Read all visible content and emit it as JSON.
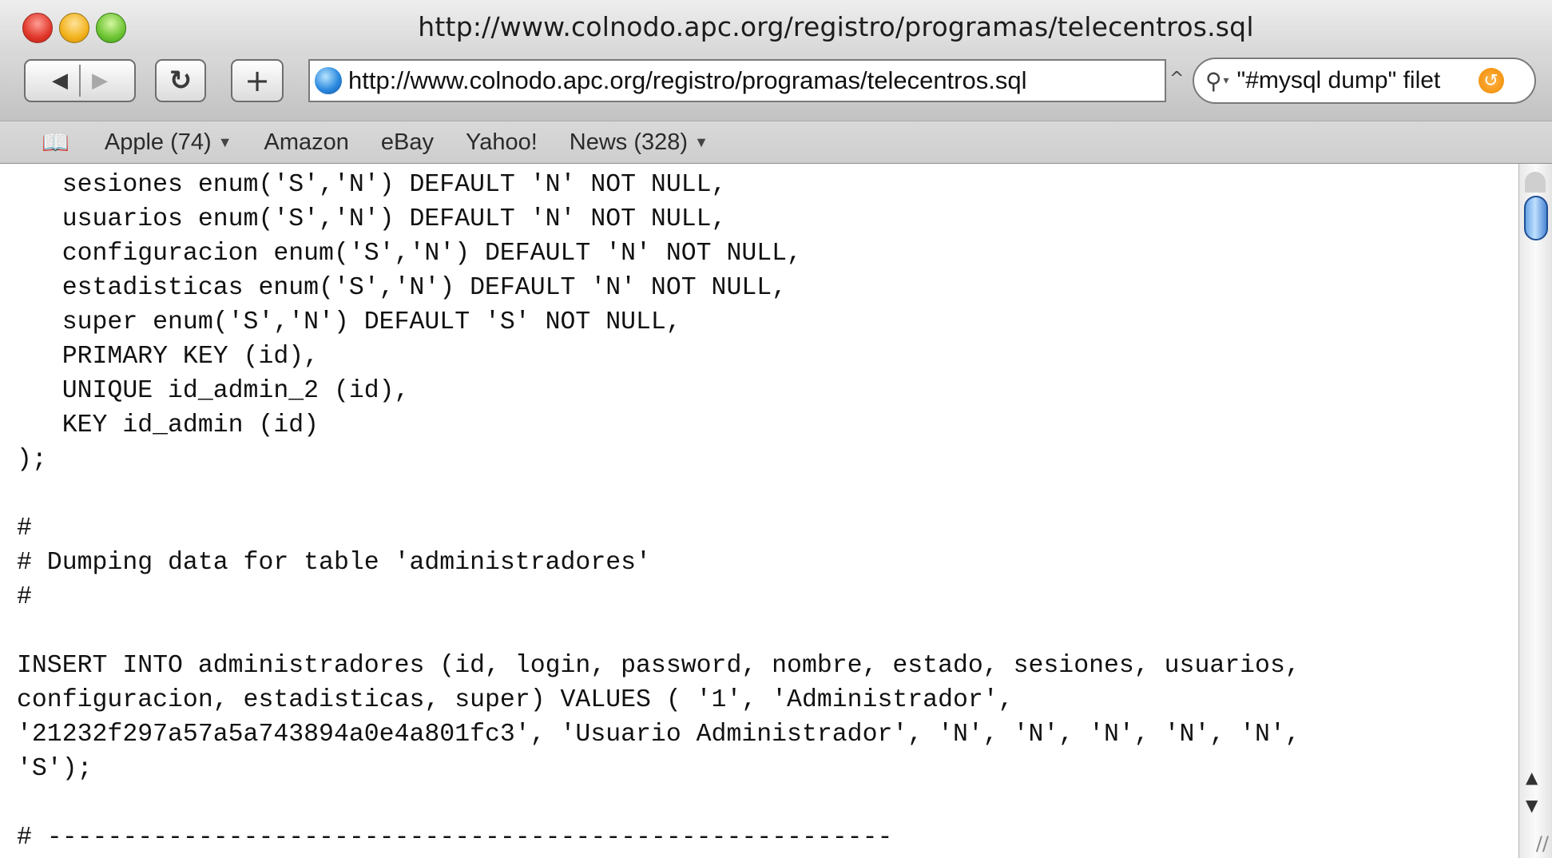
{
  "window": {
    "title": "http://www.colnodo.apc.org/registro/programas/telecentros.sql"
  },
  "toolbar": {
    "back_icon": "◀",
    "forward_icon": "▶",
    "reload_icon": "↻",
    "add_bookmark_icon": "+",
    "url_value": "http://www.colnodo.apc.org/registro/programas/telecentros.sql",
    "snapback_icon": "^",
    "search_value": "\"#mysql dump\" filet",
    "search_menu_icon": "▾",
    "search_clear_icon": "↺"
  },
  "bookmarks_bar": {
    "items": [
      {
        "label": "Apple (74)",
        "has_menu": true
      },
      {
        "label": "Amazon",
        "has_menu": false
      },
      {
        "label": "eBay",
        "has_menu": false
      },
      {
        "label": "Yahoo!",
        "has_menu": false
      },
      {
        "label": "News (328)",
        "has_menu": true
      }
    ]
  },
  "content": {
    "lines": [
      "   sesiones enum('S','N') DEFAULT 'N' NOT NULL,",
      "   usuarios enum('S','N') DEFAULT 'N' NOT NULL,",
      "   configuracion enum('S','N') DEFAULT 'N' NOT NULL,",
      "   estadisticas enum('S','N') DEFAULT 'N' NOT NULL,",
      "   super enum('S','N') DEFAULT 'S' NOT NULL,",
      "   PRIMARY KEY (id),",
      "   UNIQUE id_admin_2 (id),",
      "   KEY id_admin (id)",
      ");",
      "",
      "#",
      "# Dumping data for table 'administradores'",
      "#",
      "",
      "INSERT INTO administradores (id, login, password, nombre, estado, sesiones, usuarios,",
      "configuracion, estadisticas, super) VALUES ( '1', 'Administrador',",
      "'21232f297a57a5a743894a0e4a801fc3', 'Usuario Administrador', 'N', 'N', 'N', 'N', 'N',",
      "'S');",
      "",
      "# --------------------------------------------------------",
      "#"
    ]
  },
  "scrollbar": {
    "up_icon": "▲",
    "down_icon": "▼"
  }
}
